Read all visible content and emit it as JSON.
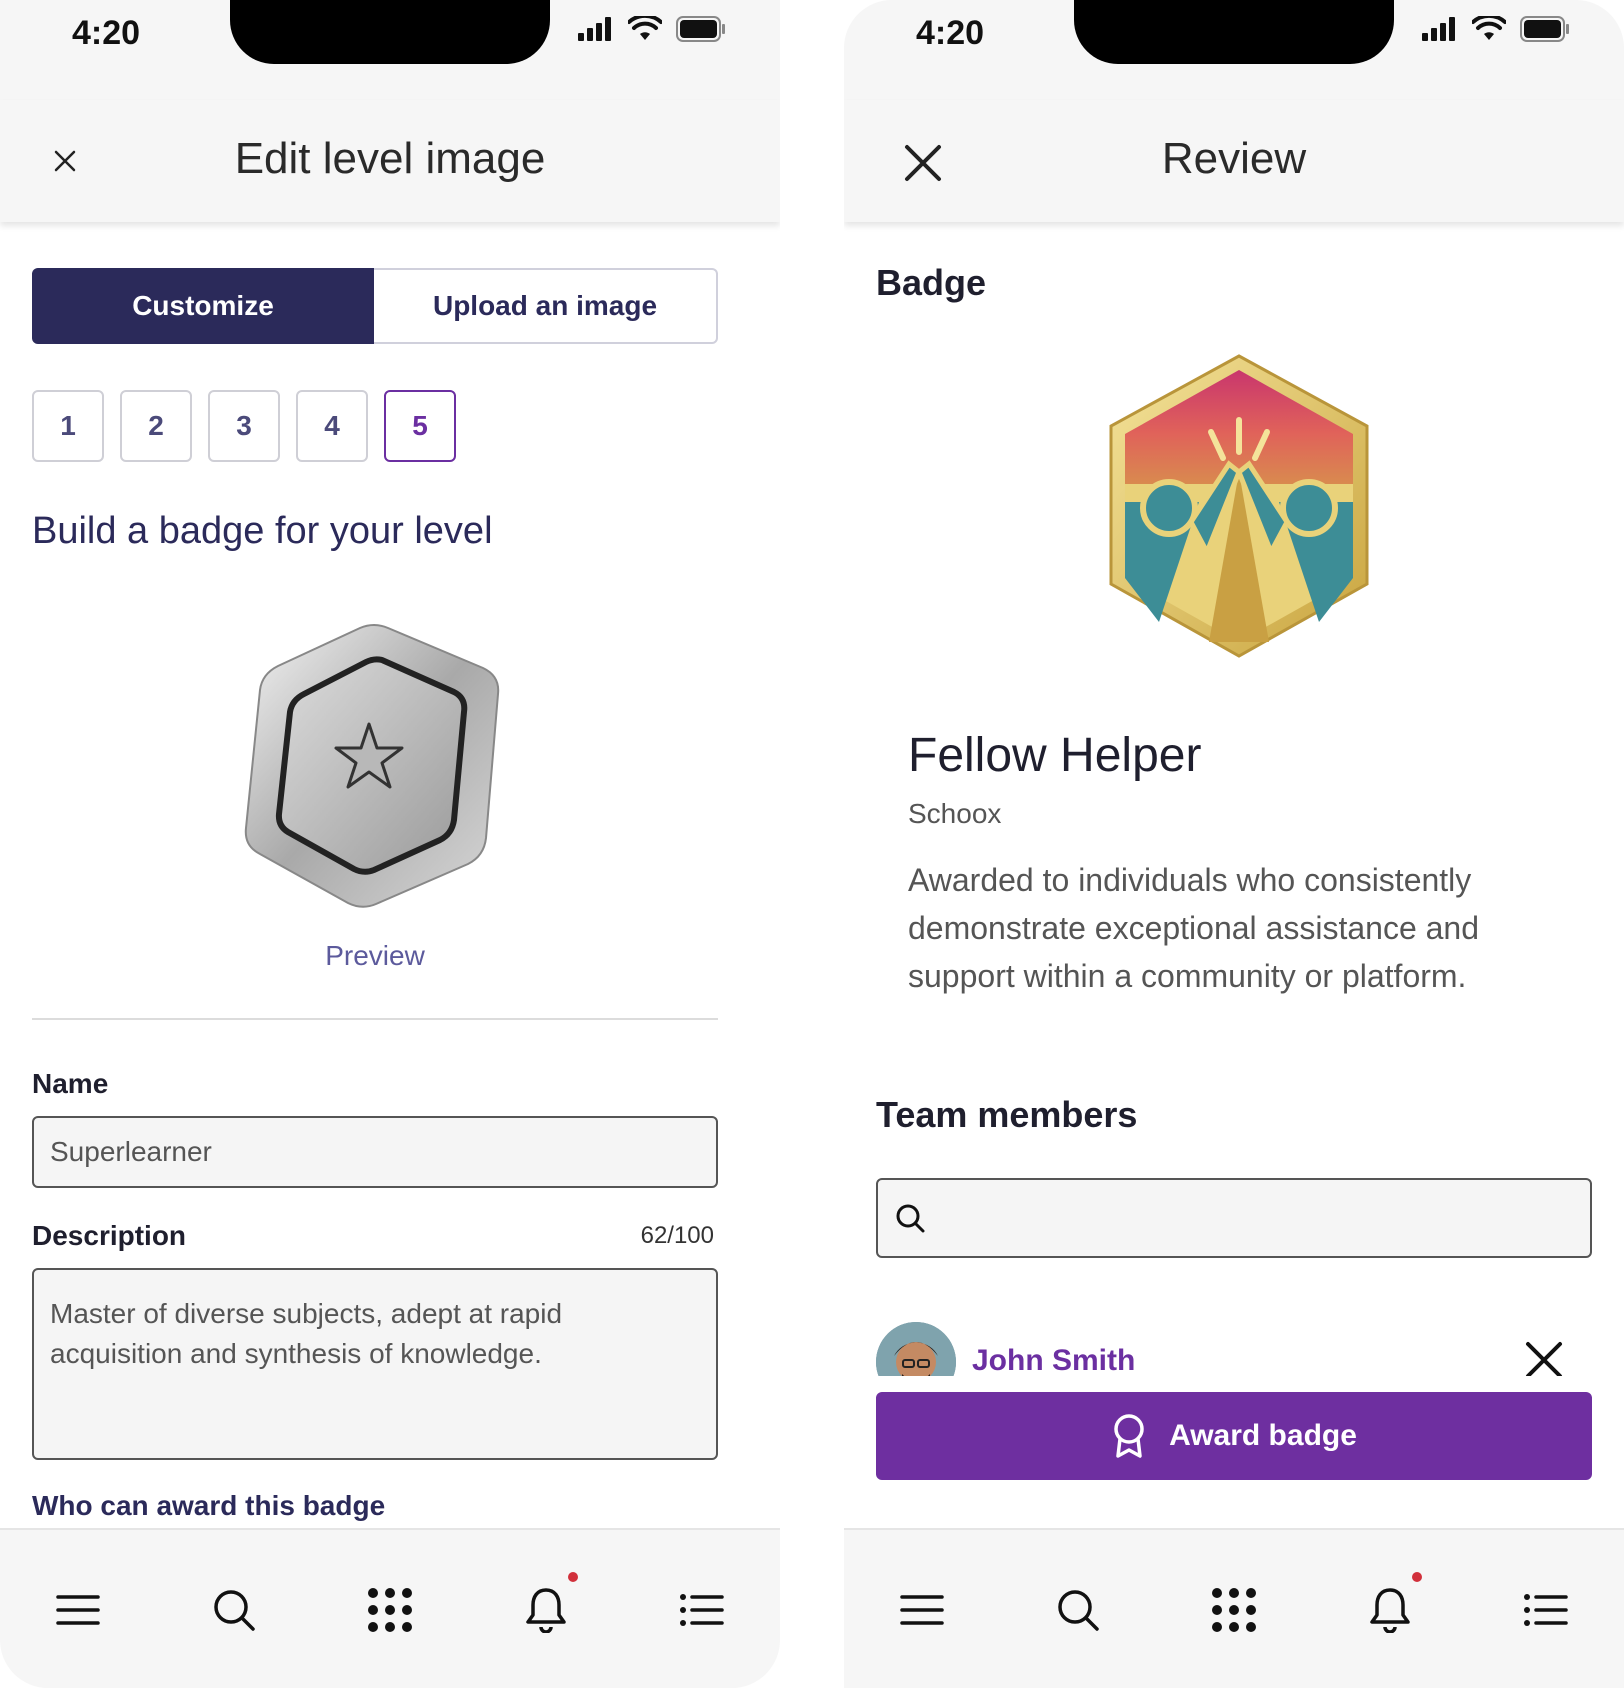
{
  "status": {
    "time": "4:20"
  },
  "left": {
    "header_title": "Edit level image",
    "tabs": {
      "customize": "Customize",
      "upload": "Upload an image"
    },
    "levels": [
      "1",
      "2",
      "3",
      "4",
      "5"
    ],
    "selected_level": "5",
    "build_title": "Build a badge for your level",
    "preview_label": "Preview",
    "name_label": "Name",
    "name_value": "Superlearner",
    "description_label": "Description",
    "description_counter": "62/100",
    "description_value": "Master of diverse subjects, adept at rapid acquisition and synthesis of knowledge.",
    "who_label": "Who can award this badge"
  },
  "right": {
    "header_title": "Review",
    "badge_section": "Badge",
    "badge_name": "Fellow Helper",
    "badge_org": "Schoox",
    "badge_description": "Awarded to individuals who consistently demonstrate exceptional assistance and support within a community or platform.",
    "team_section": "Team members",
    "search_value": "",
    "member_name": "John Smith",
    "award_button": "Award badge"
  },
  "colors": {
    "navy": "#2b2a5a",
    "purple": "#6e2fa0",
    "notification_dot": "#d1303b"
  },
  "icons": {
    "close": "close-icon",
    "menu": "hamburger-menu-icon",
    "search": "search-icon",
    "apps": "apps-grid-icon",
    "bell": "bell-icon",
    "list": "list-icon",
    "award": "award-ribbon-icon"
  }
}
